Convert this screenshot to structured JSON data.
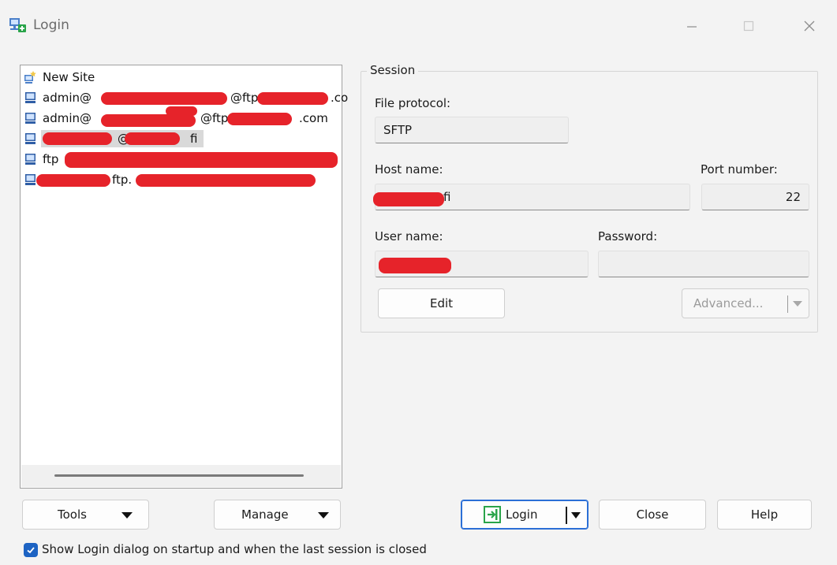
{
  "window": {
    "title": "Login",
    "minimize_glyph": "—",
    "maximize_glyph": "☐",
    "close_glyph": "✕"
  },
  "sites": [
    {
      "icon": "new-site-icon",
      "label": "New Site",
      "selected": false
    },
    {
      "icon": "computer-icon",
      "label": "admin@",
      "suffix": "@ftp",
      "tail": ".co",
      "selected": false
    },
    {
      "icon": "computer-icon",
      "label": "admin@",
      "suffix": "@ftp",
      "tail": ".com",
      "selected": false
    },
    {
      "icon": "computer-icon",
      "label": "",
      "suffix": "@",
      "tail": "fi",
      "selected": true
    },
    {
      "icon": "computer-icon",
      "label": "ftp",
      "suffix": "",
      "tail": "",
      "selected": false
    },
    {
      "icon": "computer-icon",
      "label": "",
      "suffix": "ftp.",
      "tail": "",
      "selected": false
    }
  ],
  "session": {
    "legend": "Session",
    "file_protocol_label": "File protocol:",
    "file_protocol_value": "SFTP",
    "host_name_label": "Host name:",
    "host_name_value": "fi",
    "port_number_label": "Port number:",
    "port_number_value": "22",
    "user_name_label": "User name:",
    "user_name_value": "",
    "password_label": "Password:",
    "password_value": "",
    "edit_label": "Edit",
    "advanced_label": "Advanced..."
  },
  "bottom": {
    "tools_label": "Tools",
    "manage_label": "Manage",
    "login_label": "Login",
    "close_label": "Close",
    "help_label": "Help",
    "show_login_label": "Show Login dialog on startup and when the last session is closed",
    "show_login_checked": true
  },
  "colors": {
    "accent": "#1d63c3",
    "redaction": "#e6232a"
  }
}
